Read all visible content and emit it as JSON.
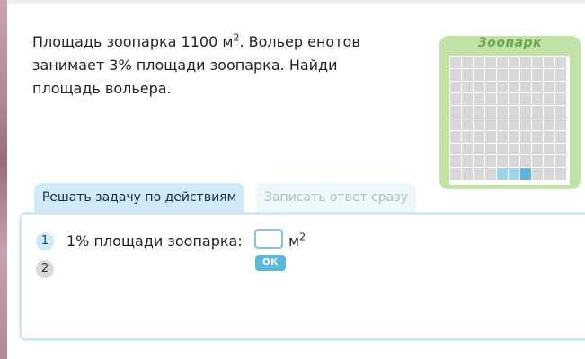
{
  "problem": {
    "line1_pre": "Площадь зоопарка 1100 м",
    "line1_sup": "2",
    "line1_post": ". Вольер енотов",
    "line2": "занимает 3% площади зоопарка. Найди",
    "line3": "площадь вольера."
  },
  "zoo": {
    "title": "Зоопарк",
    "grid": {
      "rows": 10,
      "cols": 10,
      "highlighted_cells": 3
    },
    "colors": {
      "card": "#c2e3a8",
      "cell": "#d7d7d9",
      "highlight": "#9fd6ee",
      "highlight_dark": "#5eb7e0"
    }
  },
  "tabs": {
    "active_label": "Решать задачу по действиям",
    "inactive_label": "Записать ответ сразу"
  },
  "steps": {
    "step1_number": "1",
    "step2_number": "2",
    "step1_label": "1% площади зоопарка:",
    "answer_value": "",
    "unit": "м",
    "unit_sup": "2",
    "ok_label": "ОК"
  },
  "colors": {
    "accent": "#5db6de",
    "tab_active": "#cfeaf6",
    "tab_inactive": "#eef7fb"
  }
}
